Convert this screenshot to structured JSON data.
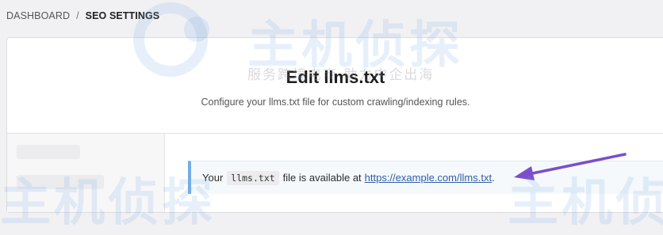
{
  "breadcrumb": {
    "items": [
      "DASHBOARD",
      "SEO SETTINGS"
    ],
    "separator": "/"
  },
  "page": {
    "title": "Edit llms.txt",
    "subtitle": "Configure your llms.txt file for custom crawling/indexing rules."
  },
  "notice": {
    "prefix": "Your",
    "code": "llms.txt",
    "middle": "file is available at",
    "link_text": "https://example.com/llms.txt",
    "suffix": "."
  },
  "watermark": {
    "brand": "主机侦探",
    "tagline": "服务跨境电商 助力中企出海"
  },
  "colors": {
    "notice_border": "#72aee6",
    "arrow": "#7b4fc9",
    "link": "#2f5ea8"
  }
}
